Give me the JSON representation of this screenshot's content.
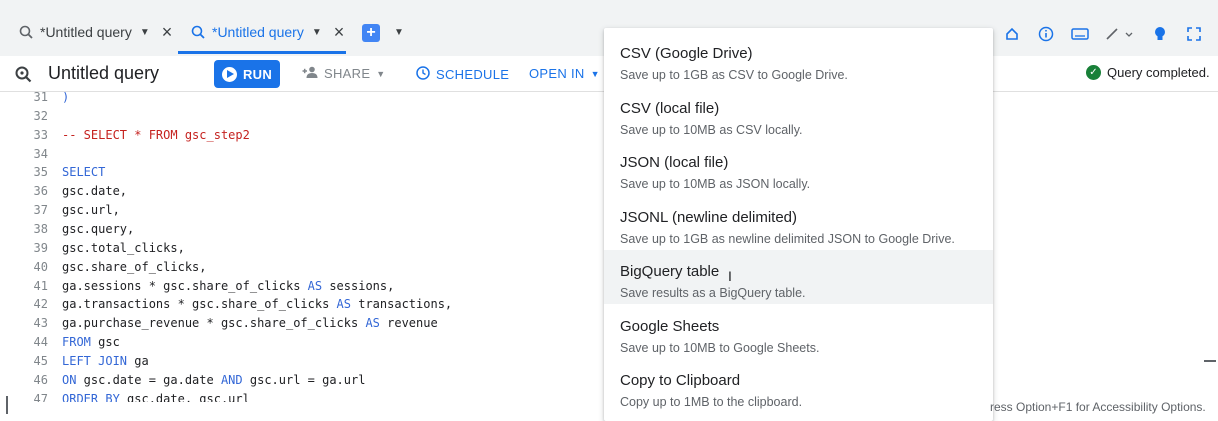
{
  "tabs": [
    {
      "label": "*Untitled query",
      "active": false
    },
    {
      "label": "*Untitled query",
      "active": true
    }
  ],
  "toolbar": {
    "title": "Untitled query",
    "run": "RUN",
    "share": "SHARE",
    "schedule": "SCHEDULE",
    "open_in": "OPEN IN",
    "status": "Query completed."
  },
  "editor": {
    "lines": [
      {
        "n": "31",
        "parts": [
          {
            "t": ")",
            "c": "kw"
          }
        ]
      },
      {
        "n": "32",
        "parts": []
      },
      {
        "n": "33",
        "parts": [
          {
            "t": "-- SELECT * FROM gsc_step2",
            "c": "cm"
          }
        ]
      },
      {
        "n": "34",
        "parts": []
      },
      {
        "n": "35",
        "parts": [
          {
            "t": "SELECT",
            "c": "kw"
          }
        ]
      },
      {
        "n": "36",
        "parts": [
          {
            "t": "gsc.date,",
            "c": ""
          }
        ]
      },
      {
        "n": "37",
        "parts": [
          {
            "t": "gsc.url,",
            "c": ""
          }
        ]
      },
      {
        "n": "38",
        "parts": [
          {
            "t": "gsc.query,",
            "c": ""
          }
        ]
      },
      {
        "n": "39",
        "parts": [
          {
            "t": "gsc.total_clicks,",
            "c": ""
          }
        ]
      },
      {
        "n": "40",
        "parts": [
          {
            "t": "gsc.share_of_clicks,",
            "c": ""
          }
        ]
      },
      {
        "n": "41",
        "parts": [
          {
            "t": "ga.sessions * gsc.share_of_clicks ",
            "c": ""
          },
          {
            "t": "AS",
            "c": "kw"
          },
          {
            "t": " sessions,",
            "c": ""
          }
        ]
      },
      {
        "n": "42",
        "parts": [
          {
            "t": "ga.transactions * gsc.share_of_clicks ",
            "c": ""
          },
          {
            "t": "AS",
            "c": "kw"
          },
          {
            "t": " transactions,",
            "c": ""
          }
        ]
      },
      {
        "n": "43",
        "parts": [
          {
            "t": "ga.purchase_revenue * gsc.share_of_clicks ",
            "c": ""
          },
          {
            "t": "AS",
            "c": "kw"
          },
          {
            "t": " revenue",
            "c": ""
          }
        ]
      },
      {
        "n": "44",
        "parts": [
          {
            "t": "FROM",
            "c": "kw"
          },
          {
            "t": " gsc",
            "c": ""
          }
        ]
      },
      {
        "n": "45",
        "parts": [
          {
            "t": "LEFT JOIN",
            "c": "kw"
          },
          {
            "t": " ga",
            "c": ""
          }
        ]
      },
      {
        "n": "46",
        "parts": [
          {
            "t": "ON",
            "c": "kw"
          },
          {
            "t": " gsc.date = ga.date ",
            "c": ""
          },
          {
            "t": "AND",
            "c": "kw"
          },
          {
            "t": " gsc.url = ga.url",
            "c": ""
          }
        ]
      },
      {
        "n": "47",
        "parts": [
          {
            "t": "ORDER BY",
            "c": "kw"
          },
          {
            "t": " gsc.date, gsc.url",
            "c": ""
          }
        ]
      }
    ]
  },
  "menu": {
    "items": [
      {
        "title": "CSV (Google Drive)",
        "desc": "Save up to 1GB as CSV to Google Drive."
      },
      {
        "title": "CSV (local file)",
        "desc": "Save up to 10MB as CSV locally."
      },
      {
        "title": "JSON (local file)",
        "desc": "Save up to 10MB as JSON locally."
      },
      {
        "title": "JSONL (newline delimited)",
        "desc": "Save up to 1GB as newline delimited JSON to Google Drive."
      },
      {
        "title": "BigQuery table",
        "desc": "Save results as a BigQuery table."
      },
      {
        "title": "Google Sheets",
        "desc": "Save up to 10MB to Google Sheets."
      },
      {
        "title": "Copy to Clipboard",
        "desc": "Copy up to 1MB to the clipboard."
      }
    ]
  },
  "accessibility_hint": "ress Option+F1 for Accessibility Options.",
  "colors": {
    "accent": "#1a73e8",
    "success": "#188038",
    "keyword": "#3367d6",
    "comment": "#c5221f"
  }
}
